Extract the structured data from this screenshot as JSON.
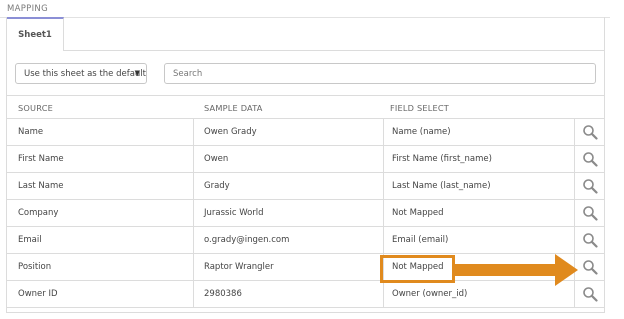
{
  "section": {
    "title": "MAPPING"
  },
  "tabs": [
    {
      "label": "Sheet1",
      "active": true
    }
  ],
  "controls": {
    "default_select": {
      "value": "Use this sheet as the default"
    },
    "search": {
      "placeholder": "Search",
      "value": ""
    }
  },
  "table": {
    "headers": {
      "source": "SOURCE",
      "sample": "SAMPLE DATA",
      "field": "FIELD SELECT"
    },
    "rows": [
      {
        "source": "Name",
        "sample": "Owen Grady",
        "field": "Name (name)"
      },
      {
        "source": "First Name",
        "sample": "Owen",
        "field": "First Name (first_name)"
      },
      {
        "source": "Last Name",
        "sample": "Grady",
        "field": "Last Name (last_name)"
      },
      {
        "source": "Company",
        "sample": "Jurassic World",
        "field": "Not Mapped"
      },
      {
        "source": "Email",
        "sample": "o.grady@ingen.com",
        "field": "Email (email)"
      },
      {
        "source": "Position",
        "sample": "Raptor Wrangler",
        "field": "Not Mapped"
      },
      {
        "source": "Owner ID",
        "sample": "2980386",
        "field": "Owner (owner_id)"
      }
    ]
  },
  "annotation": {
    "color": "#e08a1e",
    "highlighted_row": "Position"
  },
  "colors": {
    "tab_accent": "#8b8fd6",
    "border": "#dcdcdc"
  },
  "icons": {
    "row_action": "magnifier-icon",
    "dropdown": "chevron-down-icon",
    "annotation": "arrow-right-icon"
  }
}
